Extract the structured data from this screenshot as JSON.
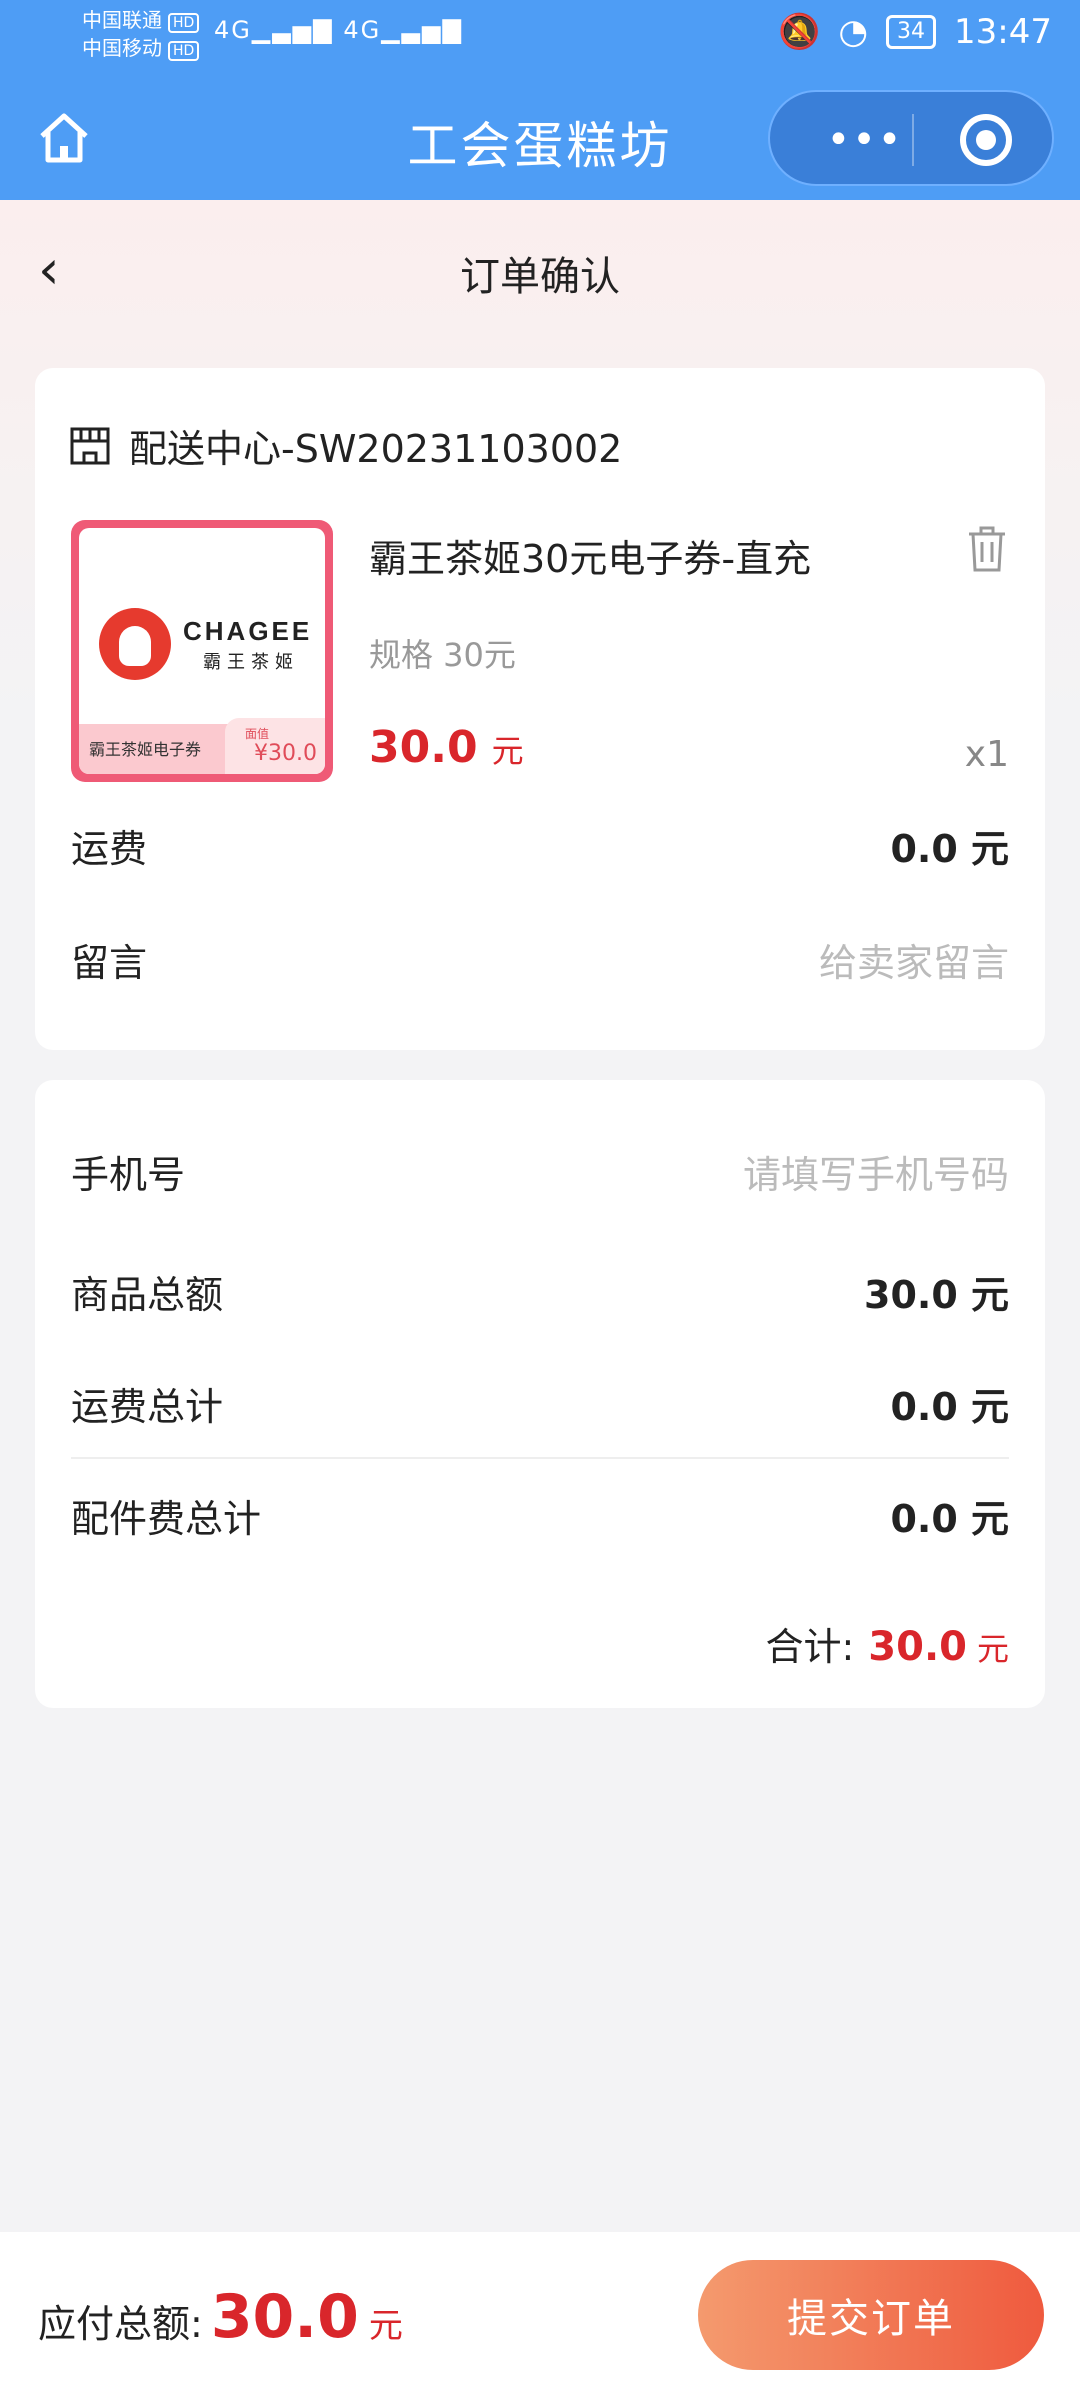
{
  "status_bar": {
    "carrier1": "中国联通",
    "carrier2": "中国移动",
    "hd": "HD",
    "net": "4G",
    "battery": "34",
    "time": "13:47"
  },
  "nav": {
    "title": "工会蛋糕坊",
    "more": "•••"
  },
  "page": {
    "title": "订单确认"
  },
  "order": {
    "store": "配送中心-SW20231103002",
    "product": {
      "name": "霸王茶姬30元电子券-直充",
      "spec": "规格 30元",
      "price": "30.0",
      "unit": "元",
      "qty": "x1",
      "thumb_brand": "CHAGEE",
      "thumb_brand_cn": "霸王茶姬",
      "thumb_caption": "霸王茶姬电子券",
      "thumb_price_label": "面值",
      "thumb_price": "¥30.0"
    },
    "shipping_label": "运费",
    "shipping_value": "0.0 元",
    "message_label": "留言",
    "message_placeholder": "给卖家留言"
  },
  "summary": {
    "phone_label": "手机号",
    "phone_placeholder": "请填写手机号码",
    "goods_total_label": "商品总额",
    "goods_total_value": "30.0 元",
    "shipping_total_label": "运费总计",
    "shipping_total_value": "0.0 元",
    "parts_total_label": "配件费总计",
    "parts_total_value": "0.0 元",
    "total_label": "合计:",
    "total_value": "30.0",
    "total_unit": "元"
  },
  "footer": {
    "pay_label": "应付总额:",
    "pay_value": "30.0",
    "pay_unit": "元",
    "submit": "提交订单"
  },
  "colors": {
    "header": "#4e9df5",
    "accent_red": "#d9262b",
    "button_from": "#f49a6e",
    "button_to": "#ef5a3e"
  }
}
